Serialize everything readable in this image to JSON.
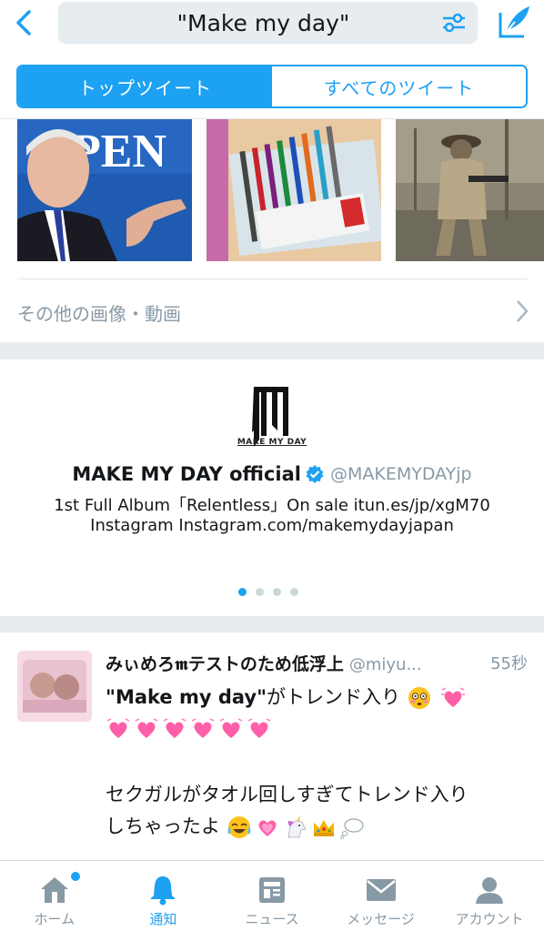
{
  "search": {
    "query": "\"Make my day\""
  },
  "segments": {
    "top": "トップツイート",
    "all": "すべてのツイート"
  },
  "media": {
    "more_label": "その他の画像・動画"
  },
  "profile_card": {
    "logo_text": "MAKE MY DAY",
    "name": "MAKE MY DAY official",
    "handle": "@MAKEMYDAYjp",
    "bio_line1": "1st Full Album「Relentless」On sale itun.es/jp/xgM70",
    "bio_line2": "Instagram Instagram.com/makemydayjapan",
    "page_count": 4,
    "active_page": 1
  },
  "tweet": {
    "name": "みぃめろ𝖒テストのため低浮上",
    "handle": "@miyu...",
    "time": "55秒",
    "line1_quote": "\"Make my day\"",
    "line1_rest": "がトレンド入り",
    "line3": "セクガルがタオル回しすぎてトレンド入り",
    "line4": "しちゃったよ"
  },
  "tabbar": {
    "home": "ホーム",
    "notifications": "通知",
    "news": "ニュース",
    "messages": "メッセージ",
    "account": "アカウント"
  },
  "colors": {
    "accent": "#1da1f2",
    "muted": "#8899a6",
    "separator": "#e6ecf0"
  }
}
